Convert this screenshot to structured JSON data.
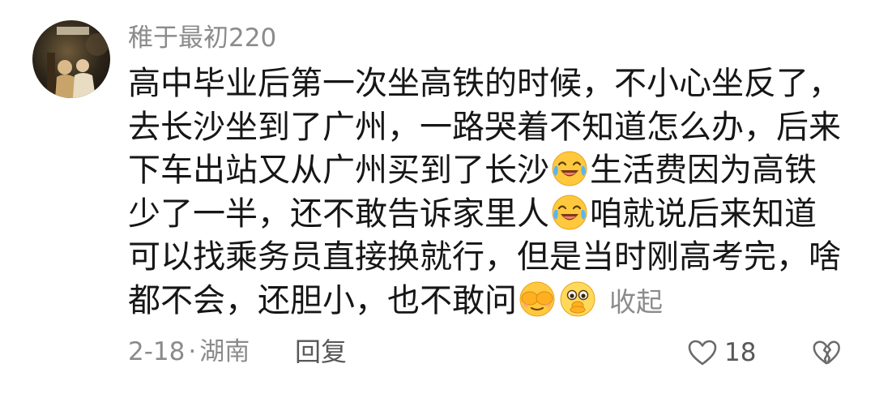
{
  "comment": {
    "username": "稚于最初220",
    "lines": [
      "高中毕业后第一次坐高铁的时候，不小心坐反了，",
      "去长沙坐到了广州，一路哭着不知道怎么办，后来",
      "下车出站又从广州买到了长沙",
      "生活费因为高铁",
      "少了一半，还不敢告诉家里人",
      "咱就说后来知道",
      "可以找乘务员直接换就行，但是当时刚高考完，啥",
      "都不会，还胆小，也不敢问"
    ],
    "collapse_label": "收起",
    "date": "2-18",
    "separator": "·",
    "location": "湖南",
    "reply_label": "回复",
    "like_count": "18"
  },
  "icons": {
    "emoji_1": "laugh-cry-emoji-icon",
    "emoji_2": "laugh-cry-emoji-icon",
    "emoji_3": "cover-face-emoji-icon",
    "emoji_4": "shocked-emoji-icon",
    "like": "heart-outline-icon",
    "dislike": "broken-heart-icon"
  },
  "colors": {
    "text_primary": "#161616",
    "text_secondary": "#8b8b8b",
    "text_action": "#585858",
    "emoji_yellow": "#FFC83D"
  }
}
